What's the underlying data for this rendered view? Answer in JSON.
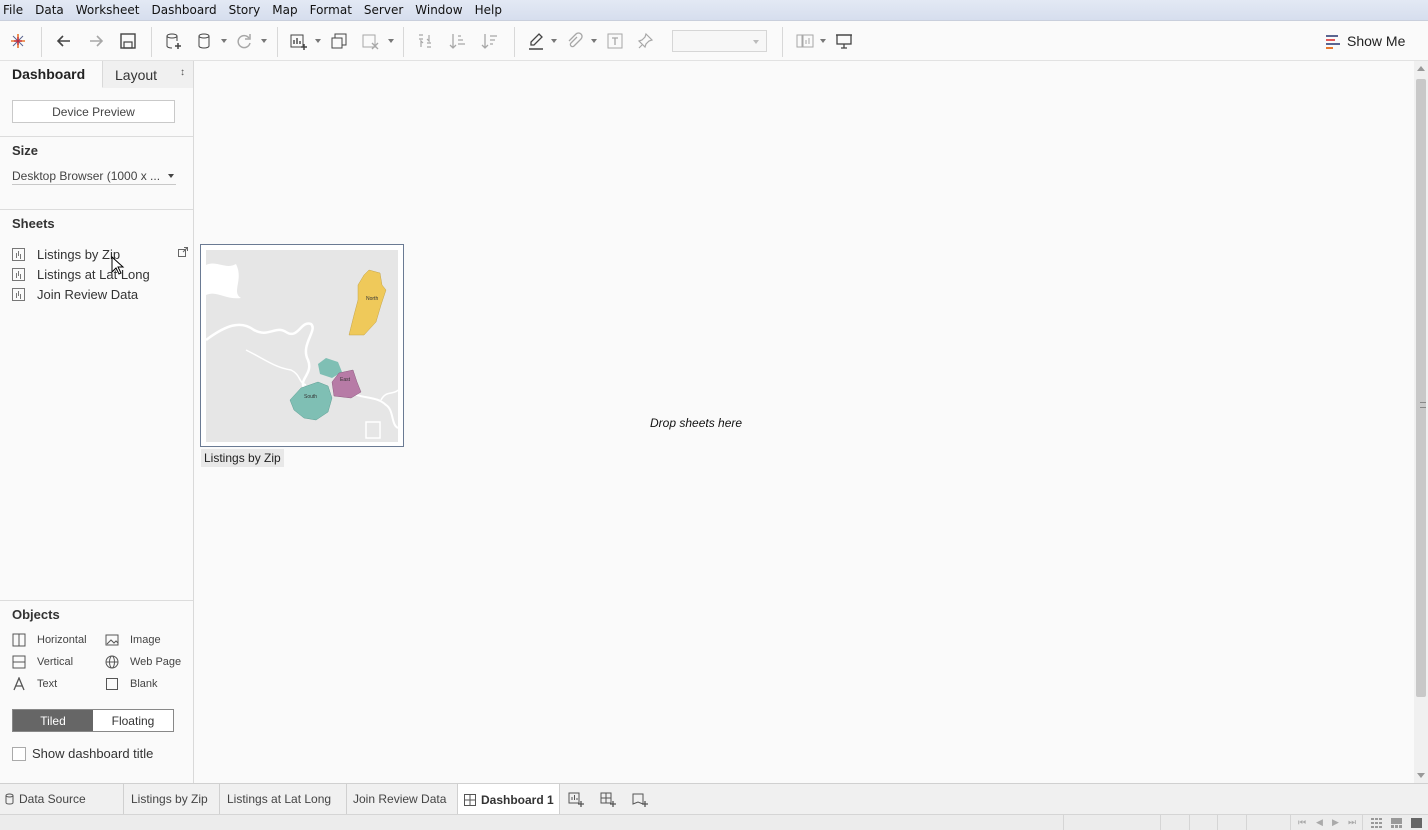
{
  "menu": [
    "File",
    "Data",
    "Worksheet",
    "Dashboard",
    "Story",
    "Map",
    "Format",
    "Server",
    "Window",
    "Help"
  ],
  "toolbar": {
    "show_me_label": "Show Me",
    "icons": [
      "tableau-logo-icon",
      "undo-icon",
      "redo-icon",
      "save-icon",
      "new-data-source-icon",
      "pause-auto-updates-icon",
      "refresh-icon",
      "new-worksheet-icon",
      "duplicate-icon",
      "clear-icon",
      "swap-icon",
      "sort-ascending-icon",
      "sort-descending-icon",
      "highlight-icon",
      "group-icon",
      "labels-icon",
      "fix-axes-icon",
      "cards-icon",
      "presentation-icon"
    ]
  },
  "left_pane": {
    "tab_dashboard": "Dashboard",
    "tab_layout": "Layout",
    "device_preview": "Device Preview",
    "size_title": "Size",
    "size_value": "Desktop Browser (1000 x ...",
    "sheets_title": "Sheets",
    "sheets": [
      "Listings by Zip",
      "Listings at Lat Long",
      "Join Review Data"
    ],
    "objects_title": "Objects",
    "objects": [
      {
        "label": "Horizontal",
        "icon": "horizontal-container-icon"
      },
      {
        "label": "Image",
        "icon": "image-icon"
      },
      {
        "label": "Vertical",
        "icon": "vertical-container-icon"
      },
      {
        "label": "Web Page",
        "icon": "globe-icon"
      },
      {
        "label": "Text",
        "icon": "text-icon"
      },
      {
        "label": "Blank",
        "icon": "blank-icon"
      }
    ],
    "tiled": "Tiled",
    "floating": "Floating",
    "show_title": "Show dashboard title"
  },
  "canvas": {
    "sheet_caption": "Listings by Zip",
    "drop_hint": "Drop sheets here",
    "map_regions": [
      {
        "label": "North",
        "color": "#efc95a"
      },
      {
        "label": "East",
        "color": "#b77ba6"
      },
      {
        "label": "South",
        "color": "#7fbfb4"
      }
    ]
  },
  "tabs": {
    "data_source": "Data Source",
    "sheets": [
      "Listings by Zip",
      "Listings at Lat Long",
      "Join Review Data"
    ],
    "active": "Dashboard 1"
  },
  "colors": {
    "menubar": "#dbe2f0",
    "accent_frame": "#6a7a93",
    "tiled_on": "#666666"
  }
}
